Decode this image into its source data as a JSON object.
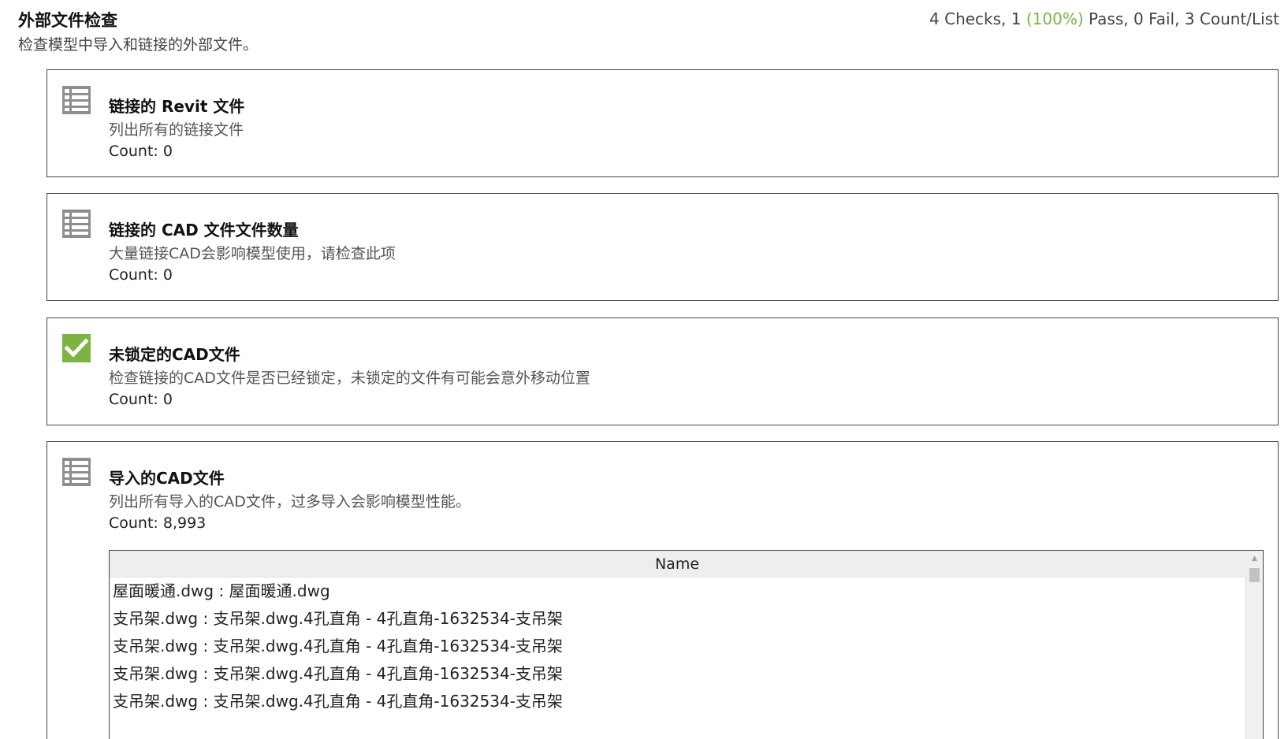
{
  "header": {
    "title": "外部文件检查",
    "subtitle": "检查模型中导入和链接的外部文件。",
    "summary_prefix": "4 Checks, 1 ",
    "summary_pct": "(100%)",
    "summary_suffix": " Pass, 0 Fail, 3 Count/List",
    "pass_color": "#7cb342"
  },
  "checks": [
    {
      "icon": "list-icon",
      "title": "链接的 Revit 文件",
      "description": "列出所有的链接文件",
      "count": "Count: 0"
    },
    {
      "icon": "list-icon",
      "title": "链接的 CAD 文件文件数量",
      "description": "大量链接CAD会影响模型使用，请检查此项",
      "count": "Count: 0"
    },
    {
      "icon": "checkmark-icon",
      "title": "未锁定的CAD文件",
      "description": "检查链接的CAD文件是否已经锁定，未锁定的文件有可能会意外移动位置",
      "count": "Count: 0"
    },
    {
      "icon": "list-icon",
      "title": "导入的CAD文件",
      "description": "列出所有导入的CAD文件，过多导入会影响模型性能。",
      "count": "Count: 8,993",
      "table": {
        "column": "Name",
        "rows": [
          "屋面暖通.dwg : 屋面暖通.dwg",
          "支吊架.dwg : 支吊架.dwg.4孔直角 - 4孔直角-1632534-支吊架",
          "支吊架.dwg : 支吊架.dwg.4孔直角 - 4孔直角-1632534-支吊架",
          "支吊架.dwg : 支吊架.dwg.4孔直角 - 4孔直角-1632534-支吊架",
          "支吊架.dwg : 支吊架.dwg.4孔直角 - 4孔直角-1632534-支吊架"
        ]
      }
    }
  ],
  "colors": {
    "list_icon": "#8e8e8e",
    "check_icon": "#7cb342",
    "border": "#444444"
  }
}
